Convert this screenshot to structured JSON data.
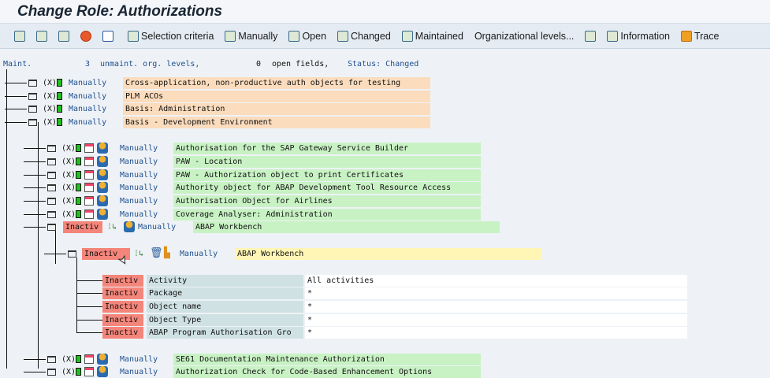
{
  "title": "Change Role: Authorizations",
  "toolbar": {
    "items": [
      {
        "icon": "expand-icon",
        "label": ""
      },
      {
        "icon": "collapse-icon",
        "label": ""
      },
      {
        "icon": "org-levels-icon",
        "label": ""
      },
      {
        "icon": "help-icon",
        "label": ""
      },
      {
        "icon": "trash-icon",
        "label": ""
      },
      {
        "icon": "selection-icon",
        "label": "Selection criteria"
      },
      {
        "icon": "manually-icon",
        "label": "Manually"
      },
      {
        "icon": "open-icon",
        "label": "Open"
      },
      {
        "icon": "changed-icon",
        "label": "Changed"
      },
      {
        "icon": "maintained-icon",
        "label": "Maintained"
      },
      {
        "icon": "",
        "label": "Organizational levels..."
      },
      {
        "icon": "grid-icon",
        "label": ""
      },
      {
        "icon": "info-icon",
        "label": "Information"
      },
      {
        "icon": "trace-icon",
        "label": "Trace"
      }
    ]
  },
  "status": {
    "maint": "Maint.",
    "unmaint_count": "3",
    "unmaint_label": "unmaint. org. levels,",
    "open_count": "0",
    "open_label": "open fields,",
    "status": "Status: Changed"
  },
  "level1": [
    {
      "status": "Manually",
      "text": "Cross-application, non-productive auth objects for testing"
    },
    {
      "status": "Manually",
      "text": "PLM ACOs"
    },
    {
      "status": "Manually",
      "text": "Basis: Administration"
    },
    {
      "status": "Manually",
      "text": "Basis - Development Environment"
    }
  ],
  "level2": [
    {
      "status": "Manually",
      "text": "Authorisation for the SAP Gateway Service Builder"
    },
    {
      "status": "Manually",
      "text": "PAW - Location"
    },
    {
      "status": "Manually",
      "text": "PAW - Authorization object to print Certificates"
    },
    {
      "status": "Manually",
      "text": "Authority object for ABAP Development Tool Resource Access"
    },
    {
      "status": "Manually",
      "text": "Authorisation Object for Airlines"
    },
    {
      "status": "Manually",
      "text": "Coverage Analyser: Administration"
    }
  ],
  "inactive_class": {
    "flag": "Inactiv",
    "status": "Manually",
    "text": "ABAP Workbench"
  },
  "inactive_auth": {
    "flag": "Inactiv",
    "status": "Manually",
    "text": "ABAP Workbench"
  },
  "fields": [
    {
      "flag": "Inactiv",
      "name": "Activity",
      "value": "All activities"
    },
    {
      "flag": "Inactiv",
      "name": "Package",
      "value": "*"
    },
    {
      "flag": "Inactiv",
      "name": "Object name",
      "value": "*"
    },
    {
      "flag": "Inactiv",
      "name": "Object Type",
      "value": "*"
    },
    {
      "flag": "Inactiv",
      "name": "ABAP Program Authorisation Gro",
      "value": "*"
    }
  ],
  "level2_after": [
    {
      "status": "Manually",
      "text": "SE61 Documentation Maintenance Authorization"
    },
    {
      "status": "Manually",
      "text": "Authorization Check for Code-Based Enhancement Options"
    }
  ]
}
